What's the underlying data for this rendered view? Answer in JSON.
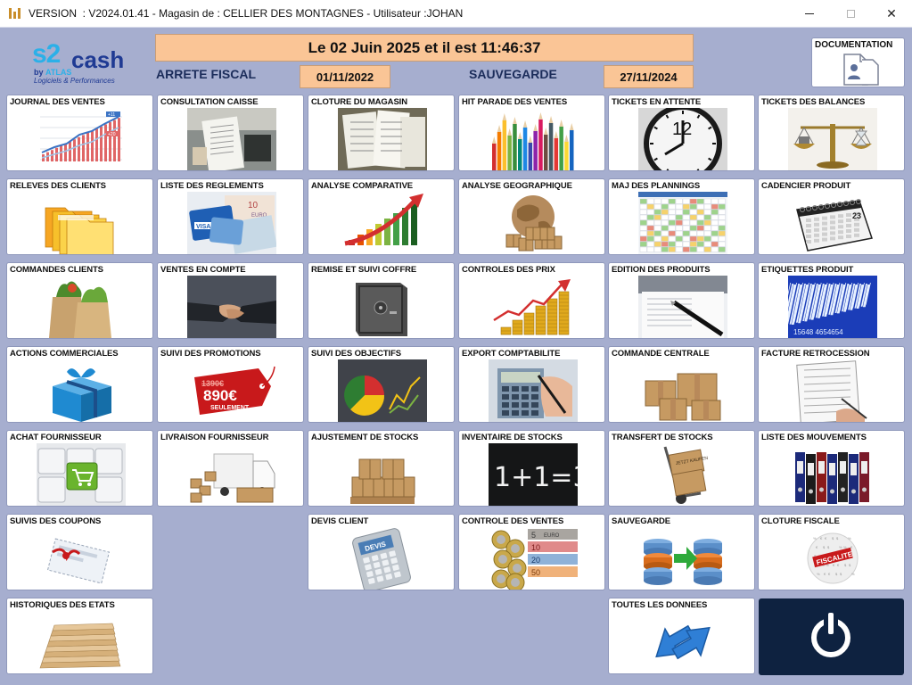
{
  "window": {
    "title": "VERSION  : V2024.01.41 - Magasin de : CELLIER DES MONTAGNES - Utilisateur :JOHAN",
    "controls": [
      "minimize",
      "maximize",
      "close"
    ],
    "close_glyph": "✕"
  },
  "logo": {
    "s2": "s2",
    "cash": "cash",
    "by": "by ",
    "atlas": "ATLAS",
    "tagline": "Logiciels & Performances"
  },
  "header": {
    "datetime": "Le 02 Juin 2025 et il est 11:46:37",
    "arrete_label": "ARRETE FISCAL",
    "arrete_value": "01/11/2022",
    "sauvegarde_label": "SAUVEGARDE",
    "sauvegarde_value": "27/11/2024",
    "documentation_label": "DOCUMENTATION"
  },
  "tiles": [
    {
      "label": "JOURNAL DES VENTES",
      "icon": "sales-chart-icon"
    },
    {
      "label": "CONSULTATION CAISSE",
      "icon": "cash-register-receipt-icon"
    },
    {
      "label": "CLOTURE DU MAGASIN",
      "icon": "receipts-icon"
    },
    {
      "label": "HIT PARADE DES VENTES",
      "icon": "colored-pencils-icon"
    },
    {
      "label": "TICKETS EN ATTENTE",
      "icon": "clock-icon"
    },
    {
      "label": "TICKETS DES BALANCES",
      "icon": "scale-icon"
    },
    {
      "label": "RELEVES DES CLIENTS",
      "icon": "folders-icon"
    },
    {
      "label": "LISTE DES REGLEMENTS",
      "icon": "cards-and-banknotes-icon"
    },
    {
      "label": "ANALYSE COMPARATIVE",
      "icon": "growth-bars-icon"
    },
    {
      "label": "ANALYSE GEOGRAPHIQUE",
      "icon": "globe-parcels-icon"
    },
    {
      "label": "MAJ DES PLANNINGS",
      "icon": "spreadsheet-icon"
    },
    {
      "label": "CADENCIER PRODUIT",
      "icon": "calendar-icon"
    },
    {
      "label": "COMMANDES CLIENTS",
      "icon": "grocery-bags-icon"
    },
    {
      "label": "VENTES EN COMPTE",
      "icon": "handshake-icon"
    },
    {
      "label": "REMISE ET SUIVI COFFRE",
      "icon": "safe-icon"
    },
    {
      "label": "CONTROLES DES PRIX",
      "icon": "coins-chart-icon"
    },
    {
      "label": "EDITION DES PRODUITS",
      "icon": "pen-document-icon"
    },
    {
      "label": "ETIQUETTES PRODUIT",
      "icon": "barcode-icon"
    },
    {
      "label": "ACTIONS COMMERCIALES",
      "icon": "gift-box-icon"
    },
    {
      "label": "SUIVI DES PROMOTIONS",
      "icon": "price-tag-icon"
    },
    {
      "label": "SUIVI DES OBJECTIFS",
      "icon": "objectives-chart-icon"
    },
    {
      "label": "EXPORT COMPTABILITE",
      "icon": "calculator-hand-icon"
    },
    {
      "label": "COMMANDE CENTRALE",
      "icon": "cardboard-boxes-icon"
    },
    {
      "label": "FACTURE RETROCESSION",
      "icon": "invoice-icon"
    },
    {
      "label": "ACHAT FOURNISSEUR",
      "icon": "cart-key-icon"
    },
    {
      "label": "LIVRAISON FOURNISSEUR",
      "icon": "delivery-truck-icon"
    },
    {
      "label": "AJUSTEMENT DE STOCKS",
      "icon": "pallet-boxes-icon"
    },
    {
      "label": "INVENTAIRE DE STOCKS",
      "icon": "chalkboard-icon"
    },
    {
      "label": "TRANSFERT DE STOCKS",
      "icon": "hand-truck-icon"
    },
    {
      "label": "LISTE DES MOUVEMENTS",
      "icon": "binders-icon"
    },
    {
      "label": "SUIVIS DES COUPONS",
      "icon": "coupon-icon"
    },
    {
      "label": "DEVIS CLIENT",
      "icon": "devis-calculator-icon"
    },
    {
      "label": "CONTROLE DES VENTES",
      "icon": "euro-notes-coins-icon"
    },
    {
      "label": "SAUVEGARDE",
      "icon": "database-transfer-icon"
    },
    {
      "label": "CLOTURE FISCALE",
      "icon": "fiscalite-ball-icon"
    },
    {
      "label": "HISTORIQUES DES ETATS",
      "icon": "paper-stack-icon"
    },
    {
      "label": "TOUTES LES DONNEES",
      "icon": "sync-arrows-icon"
    }
  ],
  "power_button": {
    "icon": "power-icon"
  },
  "images": {
    "journal": {
      "badge_top": "+11",
      "badge_bottom": "+20"
    },
    "clock": {
      "number": "12"
    },
    "cards": {
      "visa": "VISA",
      "note": "10",
      "euro": "EURO"
    },
    "barcode": {
      "digits": "15648 4654654"
    },
    "promo": {
      "old_price": "1390€",
      "new_price": "890€",
      "caption": "SEULEMENT"
    },
    "chalk": {
      "equation": "1+1=3"
    },
    "devis": {
      "screen": "DEVIS"
    },
    "transfer_box": {
      "text": "JETZT KAUFEN"
    },
    "fiscal": {
      "word": "FISCALITE"
    },
    "euro_notes": {
      "n5": "5",
      "n10": "10",
      "n20": "20",
      "n50": "50",
      "word": "EURO"
    }
  },
  "colors": {
    "background": "#a6aecf",
    "date_box": "#fac596",
    "power_tile": "#0e2240",
    "label_blue": "#1b2c5a"
  }
}
